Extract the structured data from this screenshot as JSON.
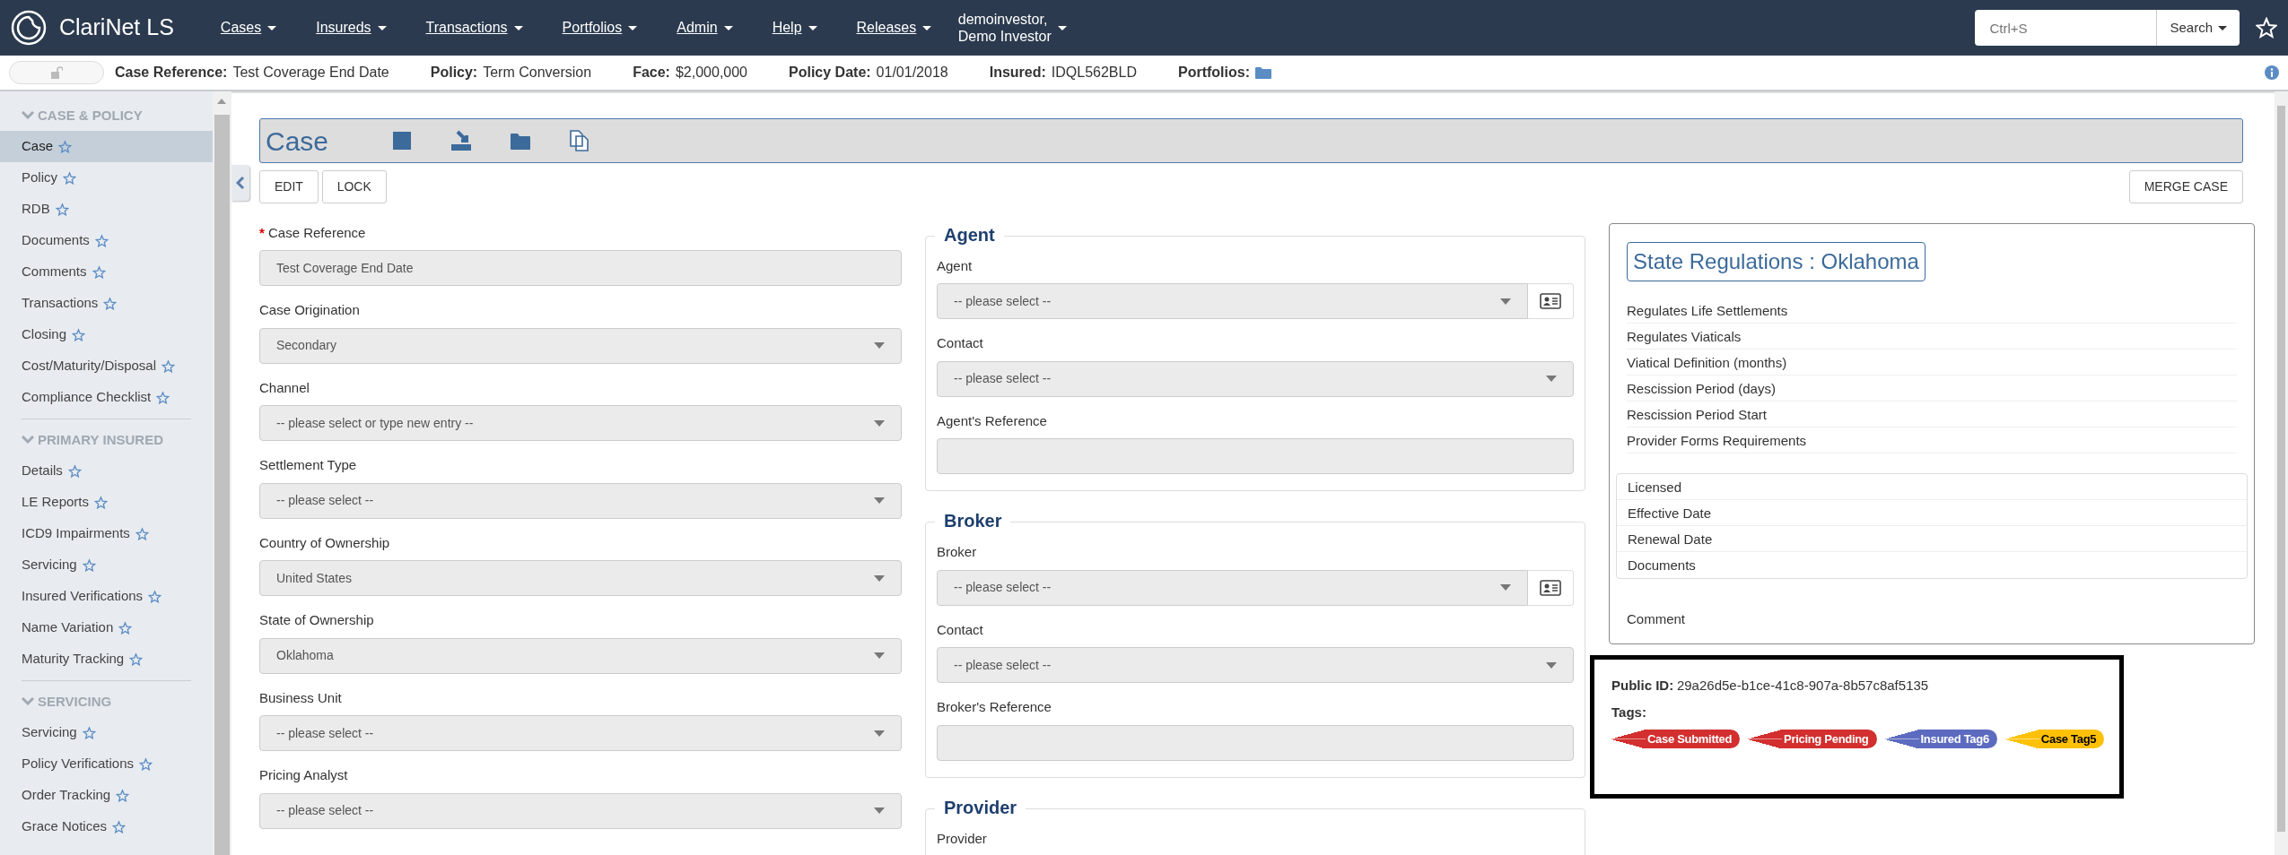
{
  "app": {
    "title": "ClariNet LS"
  },
  "menu": [
    {
      "label": "Cases"
    },
    {
      "label": "Insureds"
    },
    {
      "label": "Transactions"
    },
    {
      "label": "Portfolios"
    },
    {
      "label": "Admin"
    },
    {
      "label": "Help"
    },
    {
      "label": "Releases"
    }
  ],
  "user": {
    "line_1": "demoinvestor,",
    "line_2": "Demo Investor"
  },
  "search": {
    "placeholder": "Ctrl+S",
    "button": "Search"
  },
  "info_bar": {
    "locked": false,
    "items": [
      {
        "label": "Case Reference:",
        "value": "Test Coverage End Date"
      },
      {
        "label": "Policy:",
        "value": "Term Conversion"
      },
      {
        "label": "Face:",
        "value": "$2,000,000"
      },
      {
        "label": "Policy Date:",
        "value": "01/01/2018"
      },
      {
        "label": "Insured:",
        "value": "IDQL562BLD"
      },
      {
        "label": "Portfolios:",
        "kind": "folder"
      }
    ]
  },
  "sidebar": {
    "sections": [
      {
        "title": "CASE & POLICY",
        "expanded": true,
        "items": [
          {
            "label": "Case",
            "selected": true
          },
          {
            "label": "Policy",
            "selected": false
          },
          {
            "label": "RDB",
            "selected": false
          },
          {
            "label": "Documents",
            "selected": false
          },
          {
            "label": "Comments",
            "selected": false
          },
          {
            "label": "Transactions",
            "selected": false
          },
          {
            "label": "Closing",
            "selected": false
          },
          {
            "label": "Cost/Maturity/Disposal",
            "selected": false
          },
          {
            "label": "Compliance Checklist",
            "selected": false
          }
        ]
      },
      {
        "title": "PRIMARY INSURED",
        "expanded": true,
        "items": [
          {
            "label": "Details",
            "selected": false
          },
          {
            "label": "LE Reports",
            "selected": false
          },
          {
            "label": "ICD9 Impairments",
            "selected": false
          },
          {
            "label": "Servicing",
            "selected": false
          },
          {
            "label": "Insured Verifications",
            "selected": false
          },
          {
            "label": "Name Variation",
            "selected": false
          },
          {
            "label": "Maturity Tracking",
            "selected": false
          }
        ]
      },
      {
        "title": "SERVICING",
        "expanded": true,
        "items": [
          {
            "label": "Servicing",
            "selected": false
          },
          {
            "label": "Policy Verifications",
            "selected": false
          },
          {
            "label": "Order Tracking",
            "selected": false
          },
          {
            "label": "Grace Notices",
            "selected": false
          }
        ]
      }
    ]
  },
  "page": {
    "title": "Case",
    "required_mark": "*",
    "buttons": [
      "EDIT",
      "LOCK"
    ],
    "merge_button": "MERGE CASE"
  },
  "left_fields": [
    {
      "label": "Case Reference",
      "required": true,
      "kind": "text",
      "value": "Test Coverage End Date"
    },
    {
      "label": "Case Origination",
      "required": false,
      "kind": "select",
      "value": "Secondary"
    },
    {
      "label": "Channel",
      "required": false,
      "kind": "select",
      "value": "-- please select or type new entry --"
    },
    {
      "label": "Settlement Type",
      "required": false,
      "kind": "select",
      "value": "-- please select --"
    },
    {
      "label": "Country of Ownership",
      "required": false,
      "kind": "select",
      "value": "United States"
    },
    {
      "label": "State of Ownership",
      "required": false,
      "kind": "select",
      "value": "Oklahoma"
    },
    {
      "label": "Business Unit",
      "required": false,
      "kind": "select",
      "value": "-- please select --"
    },
    {
      "label": "Pricing Analyst",
      "required": false,
      "kind": "select",
      "value": "-- please select --"
    }
  ],
  "groups": [
    {
      "title": "Agent",
      "fields": [
        {
          "label": "Agent",
          "kind": "select",
          "lookup": true,
          "value": "-- please select --"
        },
        {
          "label": "Contact",
          "kind": "select",
          "lookup": false,
          "value": "-- please select --"
        },
        {
          "label": "Agent's Reference",
          "kind": "text",
          "lookup": false
        }
      ]
    },
    {
      "title": "Broker",
      "fields": [
        {
          "label": "Broker",
          "kind": "select",
          "lookup": true,
          "value": "-- please select --"
        },
        {
          "label": "Contact",
          "kind": "select",
          "lookup": false,
          "value": "-- please select --"
        },
        {
          "label": "Broker's Reference",
          "kind": "text",
          "lookup": false
        }
      ]
    },
    {
      "title": "Provider",
      "fields": [
        {
          "label": "Provider"
        }
      ]
    }
  ],
  "regulations": {
    "title": "State Regulations : Oklahoma",
    "rules": [
      "Regulates Life Settlements",
      "Regulates Viaticals",
      "Viatical Definition (months)",
      "Rescission Period (days)",
      "Rescission Period Start",
      "Provider Forms Requirements"
    ],
    "details": [
      "Licensed",
      "Effective Date",
      "Renewal Date",
      "Documents"
    ],
    "comment_label": "Comment"
  },
  "meta": {
    "public_id_label": "Public ID:",
    "public_id": "29a26d5e-b1ce-41c8-907a-8b57c8af5135",
    "tags_label": "Tags:",
    "tags": [
      {
        "label": "Case Submitted",
        "color": "#d32f2f"
      },
      {
        "label": "Pricing Pending",
        "color": "#d32f2f"
      },
      {
        "label": "Insured Tag6",
        "color": "#5c6bc0"
      },
      {
        "label": "Case Tag5",
        "color": "#ffc107"
      }
    ]
  }
}
